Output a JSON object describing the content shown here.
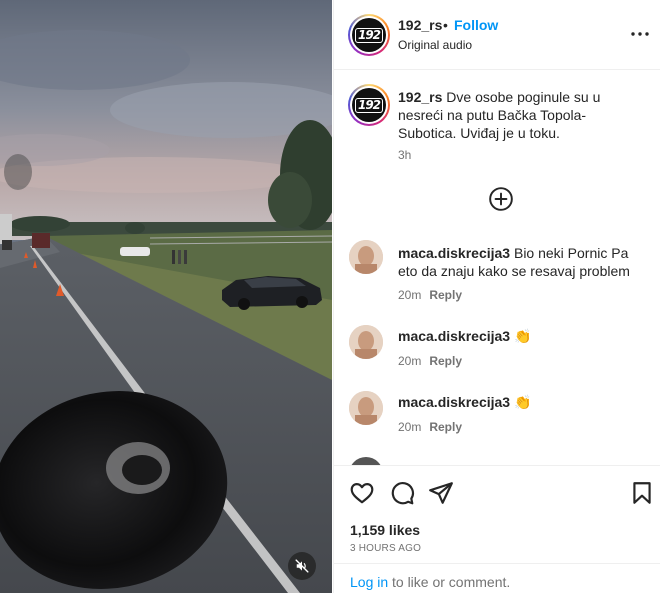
{
  "media": {
    "type": "video",
    "mute_icon": "muted-speaker-icon"
  },
  "header": {
    "username": "192_rs",
    "separator": "•",
    "follow_label": "Follow",
    "subtitle": "Original audio",
    "avatar_logo": "192",
    "more_icon": "more-horizontal-icon"
  },
  "caption": {
    "username": "192_rs",
    "text": "Dve osobe poginule su u nesreći na putu Bačka Topola-Subotica. Uviđaj je u toku.",
    "time": "3h"
  },
  "load_more_icon": "plus-circle-icon",
  "comments": [
    {
      "username": "maca.diskrecija3",
      "text": "Bio neki Pornic Pa eto da znaju kako se resavaj problem",
      "time": "20m",
      "reply_label": "Reply"
    },
    {
      "username": "maca.diskrecija3",
      "text": "👏",
      "time": "20m",
      "reply_label": "Reply"
    },
    {
      "username": "maca.diskrecija3",
      "text": "👏",
      "time": "20m",
      "reply_label": "Reply"
    }
  ],
  "actions": {
    "like_icon": "heart-icon",
    "comment_icon": "comment-icon",
    "share_icon": "share-icon",
    "save_icon": "bookmark-icon",
    "likes_text": "1,159 likes",
    "posted_time": "3 HOURS AGO"
  },
  "login": {
    "link_label": "Log in",
    "rest_text": "to like or comment."
  },
  "colors": {
    "accent": "#0095f6",
    "text": "#262626",
    "muted": "#737373",
    "divider": "#efefef"
  }
}
